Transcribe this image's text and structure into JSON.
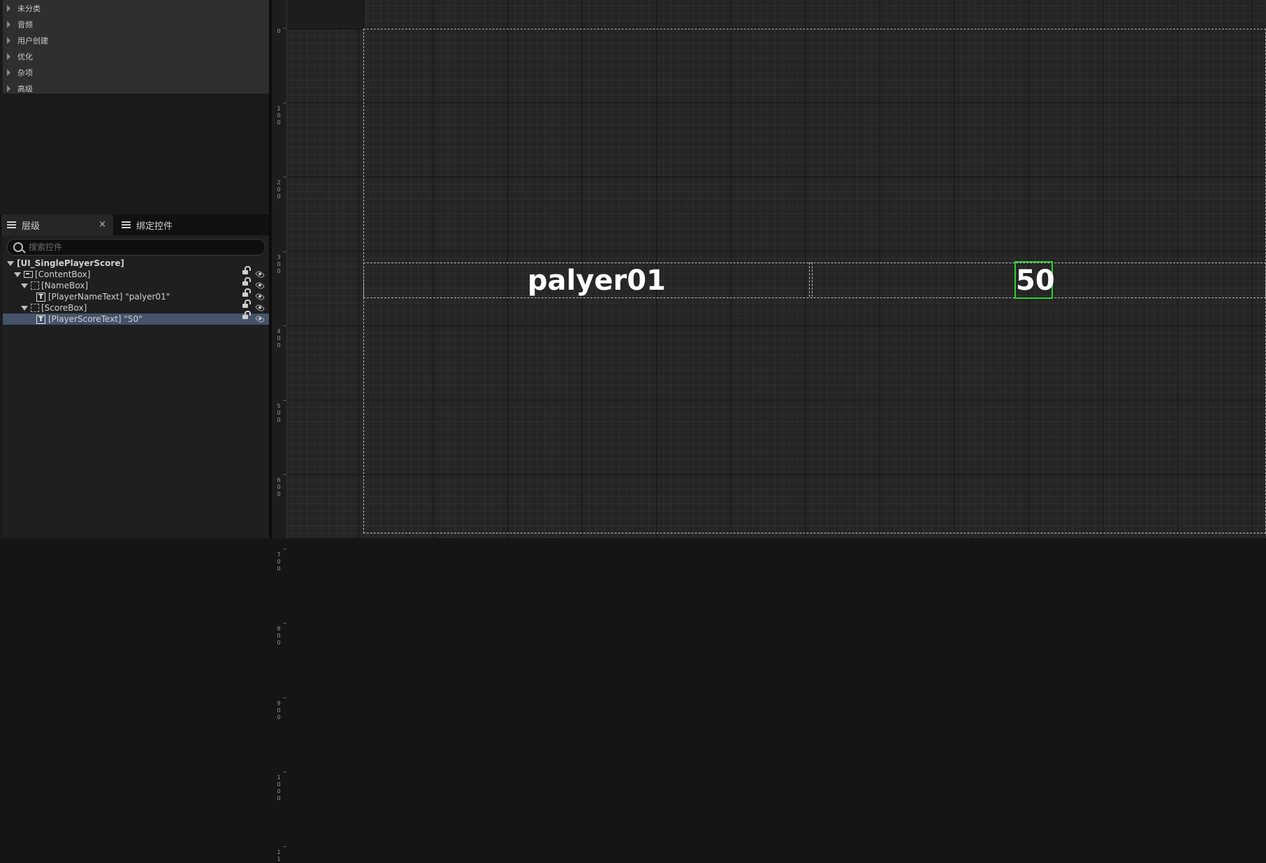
{
  "details": {
    "categories": [
      {
        "label": "未分类"
      },
      {
        "label": "音频"
      },
      {
        "label": "用户创建"
      },
      {
        "label": "优化"
      },
      {
        "label": "杂项"
      },
      {
        "label": "高级"
      }
    ]
  },
  "tabs": {
    "hierarchy_label": "层级",
    "bind_label": "绑定控件",
    "close_glyph": "×"
  },
  "search": {
    "placeholder": "搜索控件"
  },
  "tree": [
    {
      "label": "[UI_SinglePlayerScore]",
      "icon": "none",
      "selected": false
    },
    {
      "label": "[ContentBox]",
      "icon": "border-icon",
      "selected": false
    },
    {
      "label": "[NameBox]",
      "icon": "box-icon",
      "selected": false
    },
    {
      "label": "[PlayerNameText] \"palyer01\"",
      "icon": "text-icon",
      "selected": false
    },
    {
      "label": "[ScoreBox]",
      "icon": "box-icon",
      "selected": false
    },
    {
      "label": "[PlayerScoreText] \"50\"",
      "icon": "text-icon",
      "selected": true
    }
  ],
  "text_icon_glyph": "T",
  "ruler": {
    "labels": [
      "0",
      "100",
      "200",
      "300",
      "400",
      "500",
      "600",
      "700",
      "800",
      "900",
      "1000",
      "11"
    ]
  },
  "canvas": {
    "player_name": "palyer01",
    "player_score": "50",
    "selection_color": "#2fd02f"
  }
}
